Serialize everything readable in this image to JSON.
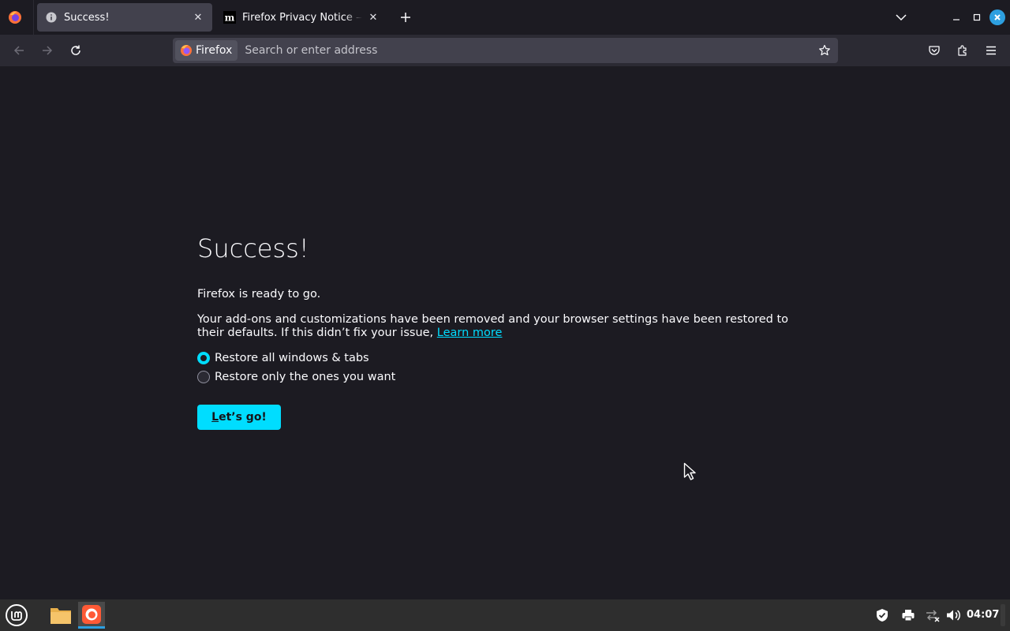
{
  "colors": {
    "accent": "#00ddff",
    "page_background": "#1c1b22",
    "toolbar_background": "#2b2a33",
    "urlbar_background": "#42414d",
    "taskbar_background": "#2e2e2e",
    "window_close": "#2d9fe0"
  },
  "tabs": [
    {
      "title": "Success!",
      "icon": "info-icon",
      "active": true
    },
    {
      "title": "Firefox Privacy Notice — Mozilla",
      "icon": "mozilla-m-icon",
      "active": false
    }
  ],
  "urlbar": {
    "identity_label": "Firefox",
    "placeholder": "Search or enter address"
  },
  "page": {
    "heading": "Success!",
    "ready_text": "Firefox is ready to go.",
    "description": "Your add-ons and customizations have been removed and your browser settings have been restored to their defaults. If this didn’t fix your issue, ",
    "learn_more": "Learn more",
    "restore_options": [
      {
        "label": "Restore all windows & tabs",
        "selected": true
      },
      {
        "label": "Restore only the ones you want",
        "selected": false
      }
    ],
    "button_first": "L",
    "button_rest": "et’s go!"
  },
  "taskbar": {
    "clock": "04:07",
    "apps": [
      "mint-menu-icon",
      "folder-icon",
      "firefox-icon"
    ],
    "tray": [
      "shield-icon",
      "printer-icon",
      "network-icon",
      "volume-icon"
    ]
  }
}
